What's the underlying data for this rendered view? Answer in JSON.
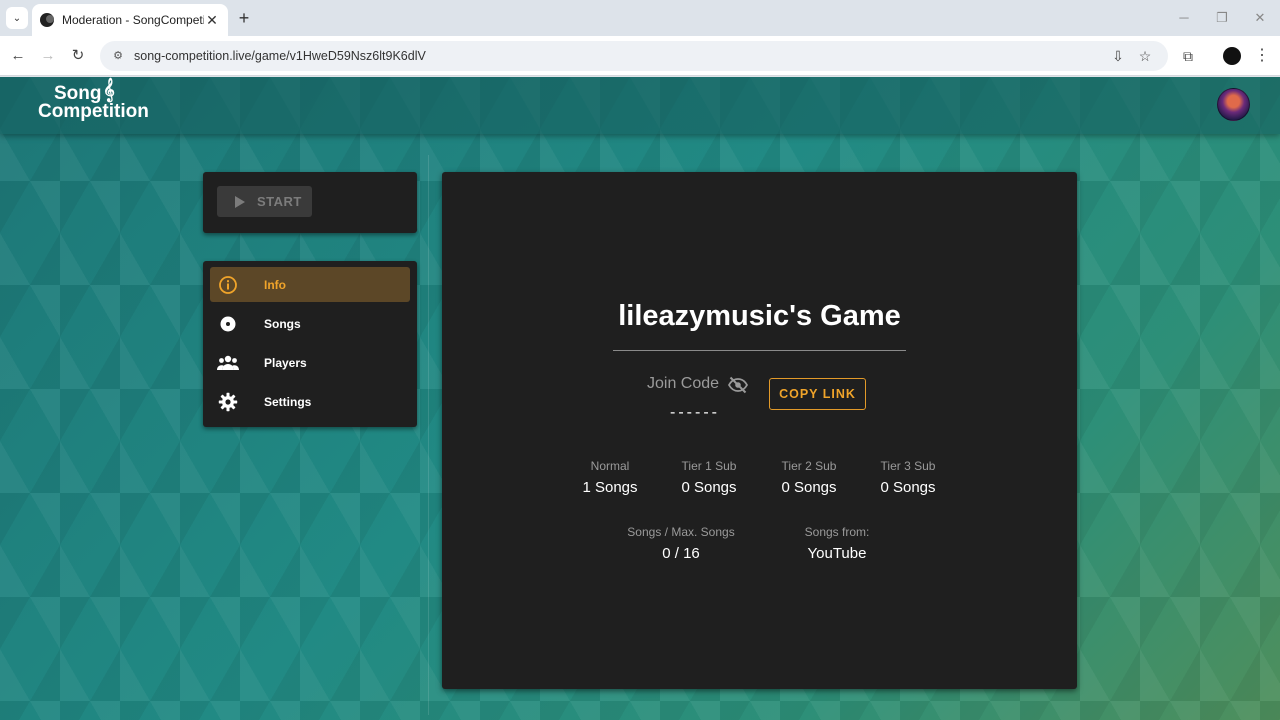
{
  "browser": {
    "tab_title": "Moderation - SongCompetition",
    "url": "song-competition.live/game/v1HweD59Nsz6lt9K6dlV"
  },
  "app": {
    "logo_line1": "Song",
    "logo_line2": "Competition"
  },
  "sidebar": {
    "start_label": "START",
    "items": [
      {
        "label": "Info",
        "icon": "info-icon",
        "active": true
      },
      {
        "label": "Songs",
        "icon": "disc-icon",
        "active": false
      },
      {
        "label": "Players",
        "icon": "group-icon",
        "active": false
      },
      {
        "label": "Settings",
        "icon": "gear-icon",
        "active": false
      }
    ]
  },
  "game": {
    "title": "lileazymusic's Game",
    "join_code_label": "Join Code",
    "join_code_value": "------",
    "copy_link_label": "COPY LINK",
    "tiers": [
      {
        "label": "Normal",
        "value": "1 Songs"
      },
      {
        "label": "Tier 1 Sub",
        "value": "0 Songs"
      },
      {
        "label": "Tier 2 Sub",
        "value": "0 Songs"
      },
      {
        "label": "Tier 3 Sub",
        "value": "0 Songs"
      }
    ],
    "songs_label": "Songs / Max. Songs",
    "songs_value": "0 / 16",
    "source_label": "Songs from:",
    "source_value": "YouTube"
  },
  "colors": {
    "accent": "#f0a42a",
    "card_bg": "#1f1f1f",
    "active_bg": "#5c4727",
    "page_bg": "#1f8080"
  }
}
